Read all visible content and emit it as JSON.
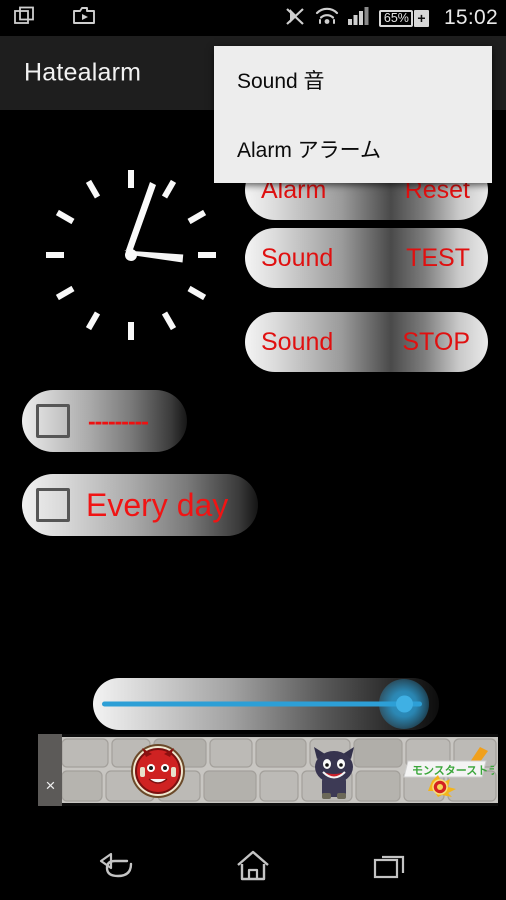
{
  "status_bar": {
    "icons": [
      {
        "name": "screenshot-icon",
        "glyph": "screenshot"
      },
      {
        "name": "camera-app-icon",
        "glyph": "camera"
      },
      {
        "name": "bluetooth-muted-icon",
        "glyph": "bt-off"
      },
      {
        "name": "wifi-icon",
        "glyph": "wifi"
      },
      {
        "name": "cellular-signal-icon",
        "glyph": "signal"
      }
    ],
    "battery_percent": "65%",
    "battery_charging_symbol": "+",
    "clock": "15:02"
  },
  "title_bar": {
    "app_title": "Hatealarm"
  },
  "overflow_menu": {
    "visible": true,
    "items": [
      {
        "label": "Sound 音"
      },
      {
        "label": "Alarm アラーム"
      }
    ]
  },
  "clock_widget": {
    "name": "analog-clock",
    "hour_hand_degrees": 95,
    "minute_hand_degrees": 9,
    "tick_count": 12,
    "hand_color": "#ffffff",
    "face_color": "#000000"
  },
  "buttons": [
    {
      "id": "alarm-reset",
      "left_label": "Alarm",
      "right_label": "Reset"
    },
    {
      "id": "sound-test",
      "left_label": "Sound",
      "right_label": "TEST"
    },
    {
      "id": "sound-stop",
      "left_label": "Sound",
      "right_label": "STOP"
    }
  ],
  "checkbox_rows": [
    {
      "id": "dashes",
      "label": "---------",
      "checked": false
    },
    {
      "id": "everyday",
      "label": "Every day",
      "checked": false
    }
  ],
  "volume_slider": {
    "name": "volume-slider",
    "value": 100,
    "min": 0,
    "max": 100,
    "track_color": "#2d9fd6",
    "thumb_color": "#3fb0e4"
  },
  "ad_banner": {
    "close_label": "×",
    "characters": [
      "red-devil-character",
      "dark-cat-character"
    ],
    "logo_text": "モンスターストライク"
  },
  "nav_bar": {
    "buttons": [
      {
        "name": "back-button"
      },
      {
        "name": "home-button"
      },
      {
        "name": "recents-button"
      }
    ]
  },
  "colors": {
    "accent_red": "#e01010",
    "slider_blue": "#2d9fd6",
    "background": "#000000",
    "title_bar": "#1e1e1e",
    "menu_background": "#ededed"
  }
}
